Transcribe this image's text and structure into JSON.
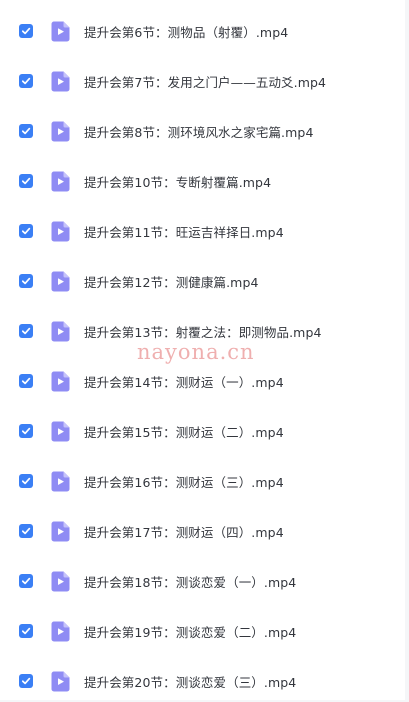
{
  "files": [
    {
      "name": "提升会第6节：测物品（射覆）.mp4",
      "checked": true,
      "icon": "video-file-icon"
    },
    {
      "name": "提升会第7节：发用之门户——五动爻.mp4",
      "checked": true,
      "icon": "video-file-icon"
    },
    {
      "name": "提升会第8节：测环境风水之家宅篇.mp4",
      "checked": true,
      "icon": "video-file-icon"
    },
    {
      "name": "提升会第10节：专断射覆篇.mp4",
      "checked": true,
      "icon": "video-file-icon"
    },
    {
      "name": "提升会第11节：旺运吉祥择日.mp4",
      "checked": true,
      "icon": "video-file-icon"
    },
    {
      "name": "提升会第12节：测健康篇.mp4",
      "checked": true,
      "icon": "video-file-icon"
    },
    {
      "name": "提升会第13节：射覆之法：即测物品.mp4",
      "checked": true,
      "icon": "video-file-icon"
    },
    {
      "name": "提升会第14节：测财运（一）.mp4",
      "checked": true,
      "icon": "video-file-icon"
    },
    {
      "name": "提升会第15节：测财运（二）.mp4",
      "checked": true,
      "icon": "video-file-icon"
    },
    {
      "name": "提升会第16节：测财运（三）.mp4",
      "checked": true,
      "icon": "video-file-icon"
    },
    {
      "name": "提升会第17节：测财运（四）.mp4",
      "checked": true,
      "icon": "video-file-icon"
    },
    {
      "name": "提升会第18节：测谈恋爱（一）.mp4",
      "checked": true,
      "icon": "video-file-icon"
    },
    {
      "name": "提升会第19节：测谈恋爱（二）.mp4",
      "checked": true,
      "icon": "video-file-icon"
    },
    {
      "name": "提升会第20节：测谈恋爱（三）.mp4",
      "checked": true,
      "icon": "video-file-icon"
    }
  ],
  "watermark": "nayona.cn",
  "colors": {
    "checkbox": "#3b7ff5",
    "file_icon": "#8f8cf4",
    "text": "#33363d",
    "watermark": "#e26e6e"
  }
}
